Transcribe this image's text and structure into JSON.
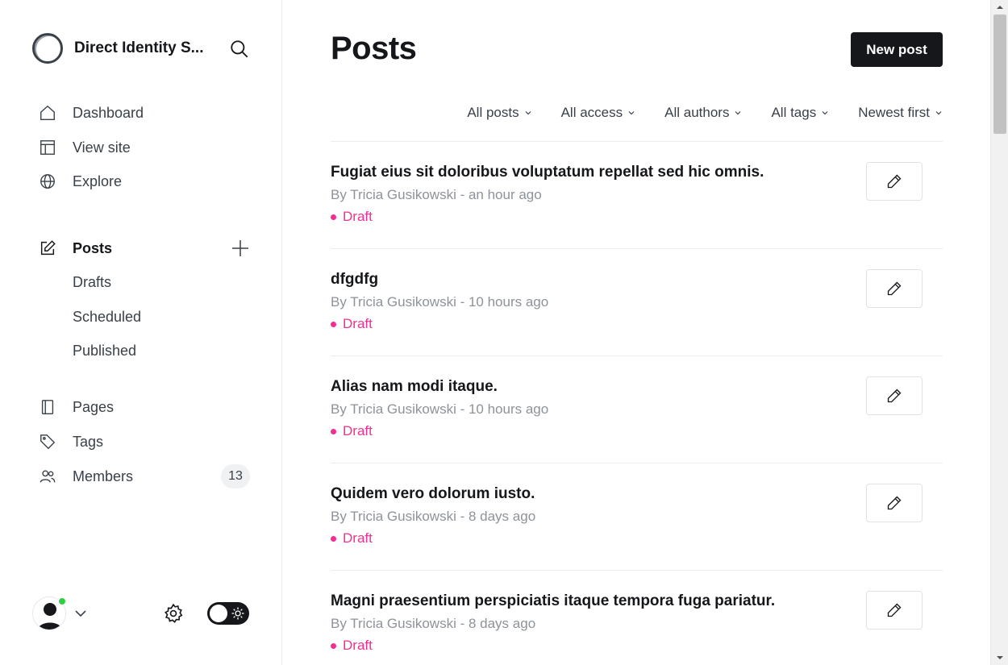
{
  "sidebar": {
    "site_name": "Direct Identity S...",
    "nav": [
      {
        "label": "Dashboard",
        "icon": "home-icon"
      },
      {
        "label": "View site",
        "icon": "layout-icon"
      },
      {
        "label": "Explore",
        "icon": "globe-icon"
      }
    ],
    "posts": {
      "label": "Posts",
      "sub": [
        "Drafts",
        "Scheduled",
        "Published"
      ]
    },
    "content_nav": [
      {
        "label": "Pages",
        "icon": "pages-icon"
      },
      {
        "label": "Tags",
        "icon": "tag-icon"
      },
      {
        "label": "Members",
        "icon": "members-icon",
        "count": "13"
      }
    ]
  },
  "main": {
    "title": "Posts",
    "new_post_label": "New post",
    "filters": [
      "All posts",
      "All access",
      "All authors",
      "All tags",
      "Newest first"
    ],
    "posts": [
      {
        "title": "Fugiat eius sit doloribus voluptatum repellat sed hic omnis.",
        "meta": "By Tricia Gusikowski - an hour ago",
        "status": "Draft"
      },
      {
        "title": "dfgdfg",
        "meta": "By Tricia Gusikowski - 10 hours ago",
        "status": "Draft"
      },
      {
        "title": "Alias nam modi itaque.",
        "meta": "By Tricia Gusikowski - 10 hours ago",
        "status": "Draft"
      },
      {
        "title": "Quidem vero dolorum iusto.",
        "meta": "By Tricia Gusikowski - 8 days ago",
        "status": "Draft"
      },
      {
        "title": "Magni praesentium perspiciatis itaque tempora fuga pariatur.",
        "meta": "By Tricia Gusikowski - 8 days ago",
        "status": "Draft"
      }
    ]
  },
  "colors": {
    "accent_draft": "#f0308e",
    "primary_button": "#15171a",
    "online": "#30cf43"
  }
}
